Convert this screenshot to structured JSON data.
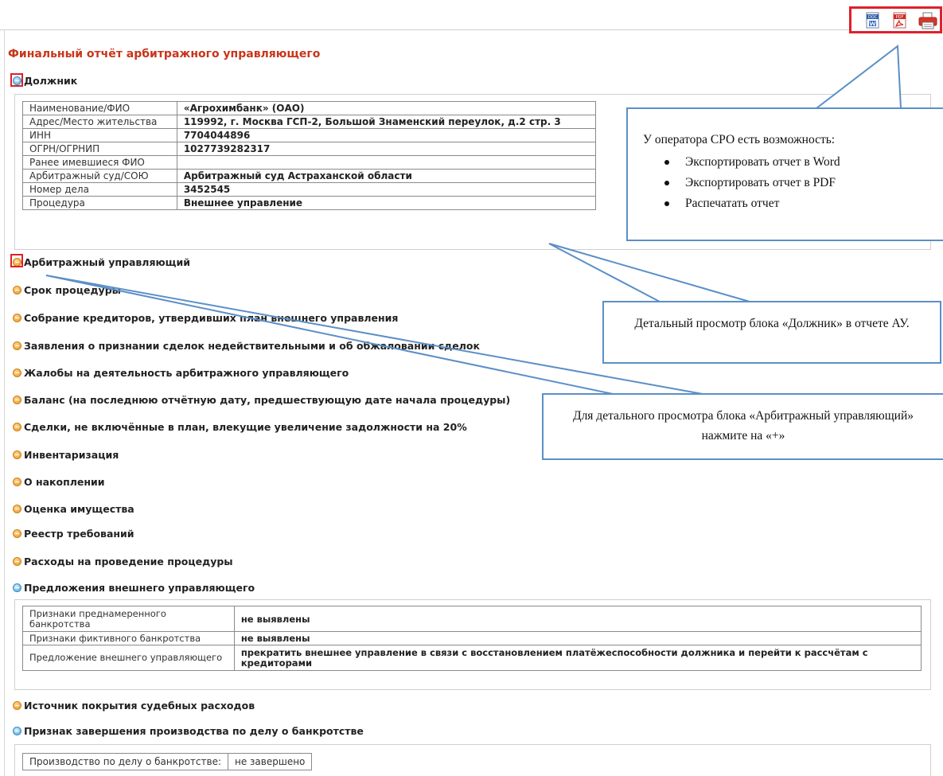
{
  "toolbar": {
    "word_icon_text": "DOC",
    "pdf_icon_text": "PDF"
  },
  "page_title": "Финальный отчёт арбитражного управляющего",
  "sections": {
    "debtor": "Должник",
    "manager": "Арбитражный управляющий",
    "term": "Срок процедуры",
    "meeting": "Собрание кредиторов, утвердивших план внешнего управления",
    "claims": "Заявления о признании сделок недействительными и об обжаловании сделок",
    "complaints": "Жалобы на деятельность арбитражного управляющего",
    "balance": "Баланс (на последнюю отчётную дату, предшествующую дате начала процедуры)",
    "deals": "Сделки, не включённые в план, влекущие увеличение задолжности на 20%",
    "inventory": "Инвентаризация",
    "accumulation": "О накоплении",
    "valuation": "Оценка имущества",
    "registry": "Реестр требований",
    "expenses": "Расходы на проведение процедуры",
    "proposals": "Предложения внешнего управляющего",
    "court_costs": "Источник покрытия судебных расходов",
    "completion": "Признак завершения производства по делу о банкротстве"
  },
  "debtor_table": [
    {
      "label": "Наименование/ФИО",
      "value": "«Агрохимбанк» (ОАО)"
    },
    {
      "label": "Адрес/Место жительства",
      "value": "119992, г. Москва ГСП-2, Большой Знаменский переулок, д.2 стр. 3"
    },
    {
      "label": "ИНН",
      "value": "7704044896"
    },
    {
      "label": "ОГРН/ОГРНИП",
      "value": "1027739282317"
    },
    {
      "label": "Ранее имевшиеся ФИО",
      "value": ""
    },
    {
      "label": "Арбитражный суд/СОЮ",
      "value": "Арбитражный суд Астраханской области"
    },
    {
      "label": "Номер дела",
      "value": "3452545"
    },
    {
      "label": "Процедура",
      "value": "Внешнее управление"
    }
  ],
  "proposals_table": [
    {
      "label": "Признаки преднамеренного банкротства",
      "value": "не выявлены"
    },
    {
      "label": "Признаки фиктивного банкротства",
      "value": "не выявлены"
    },
    {
      "label": "Предложение внешнего управляющего",
      "value": "прекратить внешнее управление в связи с восстановлением платёжеспособности должника и перейти к рассчётам с кредиторами"
    }
  ],
  "completion_table": {
    "label": "Производство по делу о банкротстве:",
    "value": "не завершено"
  },
  "callouts": {
    "export": {
      "intro": "У оператора СРО есть возможность:",
      "items": [
        "Экспортировать отчет в Word",
        "Экспортировать отчет в PDF",
        "Распечатать отчет"
      ]
    },
    "debtor_view": "Детальный просмотр блока «Должник» в отчете АУ.",
    "manager_view": "Для детального просмотра блока «Арбитражный управляющий» нажмите на «+»"
  },
  "colors": {
    "title_red": "#c8351a",
    "highlight_red": "#e0202a",
    "callout_blue": "#5b8fc7",
    "expand_orange": "#e8941c",
    "collapse_blue": "#4ba3d8"
  }
}
